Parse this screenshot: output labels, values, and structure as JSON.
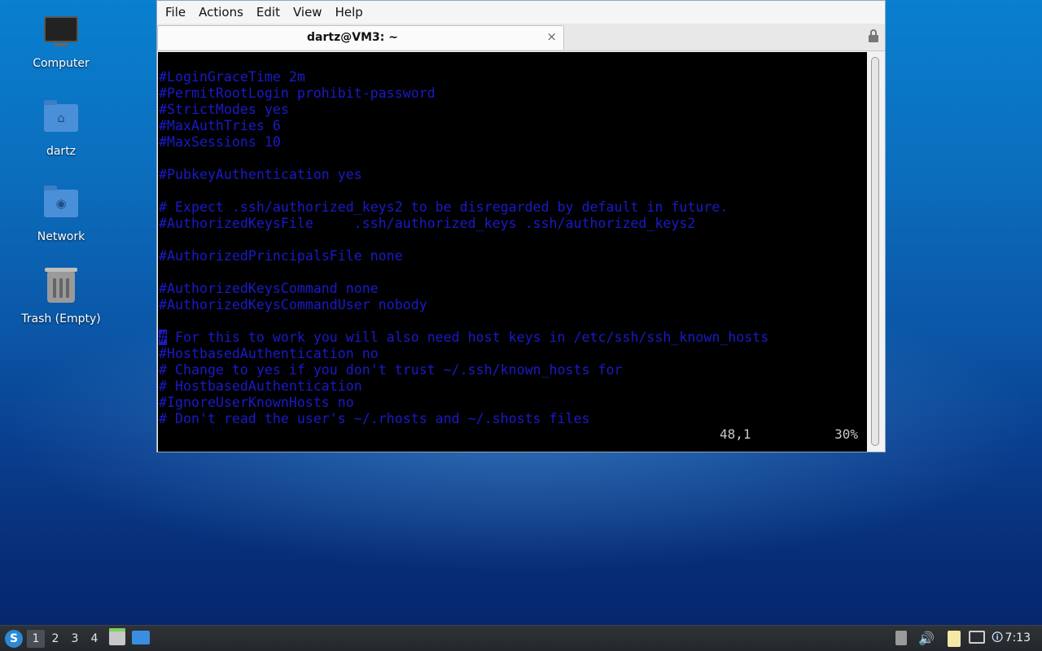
{
  "desktop": {
    "icons": [
      {
        "label": "Computer",
        "icon": "computer-icon"
      },
      {
        "label": "dartz",
        "icon": "home-folder-icon"
      },
      {
        "label": "Network",
        "icon": "network-folder-icon"
      },
      {
        "label": "Trash (Empty)",
        "icon": "trash-icon"
      }
    ]
  },
  "window": {
    "menu": [
      "File",
      "Actions",
      "Edit",
      "View",
      "Help"
    ],
    "tab_title": "dartz@VM3: ~",
    "tab_close": "×",
    "terminal_lines": [
      "#LoginGraceTime 2m",
      "#PermitRootLogin prohibit-password",
      "#StrictModes yes",
      "#MaxAuthTries 6",
      "#MaxSessions 10",
      "",
      "#PubkeyAuthentication yes",
      "",
      "# Expect .ssh/authorized_keys2 to be disregarded by default in future.",
      "#AuthorizedKeysFile     .ssh/authorized_keys .ssh/authorized_keys2",
      "",
      "#AuthorizedPrincipalsFile none",
      "",
      "#AuthorizedKeysCommand none",
      "#AuthorizedKeysCommandUser nobody",
      "",
      "# For this to work you will also need host keys in /etc/ssh/ssh_known_hosts",
      "#HostbasedAuthentication no",
      "# Change to yes if you don't trust ~/.ssh/known_hosts for",
      "# HostbasedAuthentication",
      "#IgnoreUserKnownHosts no",
      "# Don't read the user's ~/.rhosts and ~/.shosts files"
    ],
    "cursor_line": 16,
    "status": {
      "position": "48,1",
      "percent": "30%"
    },
    "colors": {
      "text": "#1a1ac8",
      "background": "#000000"
    }
  },
  "taskbar": {
    "workspaces": [
      "1",
      "2",
      "3",
      "4"
    ],
    "active_workspace": "1",
    "volume_glyph": "🔊",
    "notify_glyph": "🛈",
    "clock": "7:13"
  }
}
